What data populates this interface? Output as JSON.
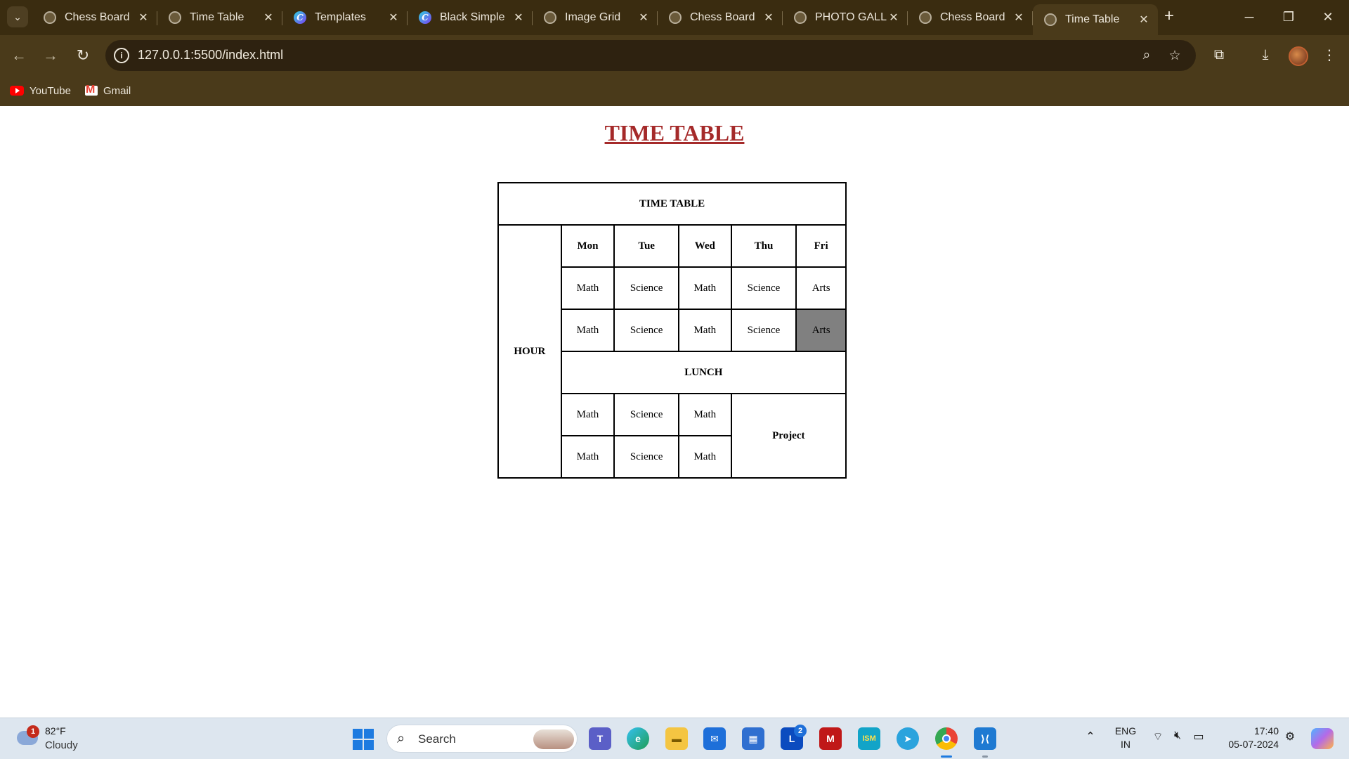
{
  "browser": {
    "menu_icon": "chevron-down-icon",
    "tabs": [
      {
        "title": "Chess Board",
        "favicon": "globe-icon"
      },
      {
        "title": "Time Table",
        "favicon": "globe-icon"
      },
      {
        "title": "Templates",
        "favicon": "canva-icon"
      },
      {
        "title": "Black Simple",
        "favicon": "canva-icon"
      },
      {
        "title": "Image Grid",
        "favicon": "globe-icon"
      },
      {
        "title": "Chess Board",
        "favicon": "globe-icon"
      },
      {
        "title": "PHOTO GALL",
        "favicon": "globe-icon"
      },
      {
        "title": "Chess Board",
        "favicon": "globe-icon"
      },
      {
        "title": "Time Table",
        "favicon": "globe-icon",
        "active": true
      }
    ],
    "close_glyph": "✕",
    "new_tab_glyph": "+",
    "url": "127.0.0.1:5500/index.html",
    "bookmarks": [
      {
        "label": "YouTube",
        "icon": "youtube-icon"
      },
      {
        "label": "Gmail",
        "icon": "gmail-icon"
      }
    ]
  },
  "page": {
    "heading": "TIME TABLE",
    "heading_color": "#a52a2a",
    "table": {
      "caption": "TIME TABLE",
      "hour_label": "HOUR",
      "days": [
        "Mon",
        "Tue",
        "Wed",
        "Thu",
        "Fri"
      ],
      "row1": [
        "Math",
        "Science",
        "Math",
        "Science",
        "Arts"
      ],
      "row2": [
        "Math",
        "Science",
        "Math",
        "Science",
        "Arts"
      ],
      "lunch": "LUNCH",
      "row3": [
        "Math",
        "Science",
        "Math"
      ],
      "row4": [
        "Math",
        "Science",
        "Math"
      ],
      "project": "Project",
      "highlight_color": "#808080"
    }
  },
  "taskbar": {
    "weather": {
      "temp": "82°F",
      "condition": "Cloudy",
      "badge": "1"
    },
    "search_placeholder": "Search",
    "apps": [
      "teams-icon",
      "edge-icon",
      "file-explorer-icon",
      "mail-icon",
      "store-icon",
      "lens-app-icon",
      "mcafee-icon",
      "cisco-ism-icon",
      "telegram-icon",
      "chrome-icon",
      "vscode-icon"
    ],
    "lens_badge": "2",
    "language": {
      "line1": "ENG",
      "line2": "IN"
    },
    "time": "17:40",
    "date": "05-07-2024"
  }
}
